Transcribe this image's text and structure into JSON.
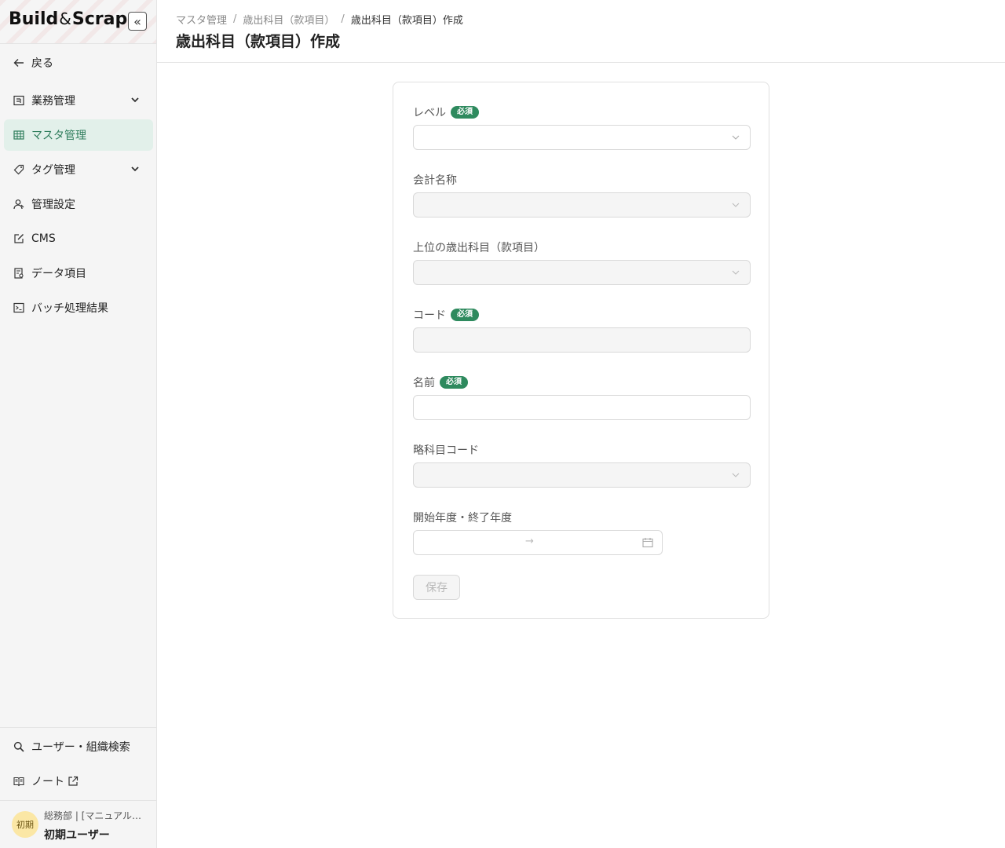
{
  "sidebar": {
    "logo": {
      "part1": "Build",
      "amp": "&",
      "part2": "Scrap"
    },
    "collapse_glyph": "«",
    "back_label": "戻る",
    "items": [
      {
        "label": "業務管理",
        "icon": "task-board-icon",
        "expandable": true
      },
      {
        "label": "マスタ管理",
        "icon": "table-icon",
        "active": true
      },
      {
        "label": "タグ管理",
        "icon": "tag-icon",
        "expandable": true
      },
      {
        "label": "管理設定",
        "icon": "admin-users-icon"
      },
      {
        "label": "CMS",
        "icon": "edit-icon"
      },
      {
        "label": "データ項目",
        "icon": "data-file-icon"
      },
      {
        "label": "バッチ処理結果",
        "icon": "terminal-icon"
      }
    ],
    "bottom_items": [
      {
        "label": "ユーザー・組織検索",
        "icon": "search-icon"
      },
      {
        "label": "ノート",
        "icon": "book-icon"
      }
    ],
    "user": {
      "avatar_text": "初期",
      "org": "総務部 | [マニュアル…",
      "name": "初期ユーザー"
    }
  },
  "header": {
    "breadcrumb": [
      "マスタ管理",
      "歳出科目（款項目）",
      "歳出科目（款項目）作成"
    ],
    "separator": "/",
    "title": "歳出科目（款項目）作成"
  },
  "form": {
    "required_badge": "必須",
    "fields": {
      "level": {
        "label": "レベル",
        "required": true,
        "value": ""
      },
      "account_name": {
        "label": "会計名称",
        "required": false,
        "value": ""
      },
      "parent_item": {
        "label": "上位の歳出科目（款項目）",
        "required": false,
        "value": ""
      },
      "code": {
        "label": "コード",
        "required": true,
        "value": ""
      },
      "name": {
        "label": "名前",
        "required": true,
        "value": ""
      },
      "short_code": {
        "label": "略科目コード",
        "required": false,
        "value": ""
      },
      "year_range": {
        "label": "開始年度・終了年度",
        "start": "",
        "end": "",
        "arrow": "→"
      }
    },
    "save_label": "保存"
  },
  "colors": {
    "accent": "#2e8a5e",
    "active_bg": "#e2f0ea",
    "active_text": "#2f7d5c",
    "sidebar_bg": "#f5f5f5",
    "disabled_bg": "#f5f5f5",
    "avatar_bg": "#fbe7a5"
  }
}
